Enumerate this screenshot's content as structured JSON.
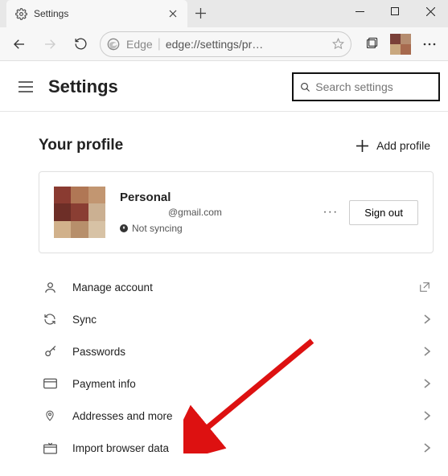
{
  "tab": {
    "title": "Settings"
  },
  "omnibox": {
    "brand": "Edge",
    "url": "edge://settings/pr…"
  },
  "page": {
    "title": "Settings"
  },
  "search": {
    "placeholder": "Search settings"
  },
  "section": {
    "title": "Your profile",
    "add_label": "Add profile"
  },
  "profile": {
    "name": "Personal",
    "email": "@gmail.com",
    "sync_status": "Not syncing",
    "signout_label": "Sign out"
  },
  "rows": [
    {
      "label": "Manage account"
    },
    {
      "label": "Sync"
    },
    {
      "label": "Passwords"
    },
    {
      "label": "Payment info"
    },
    {
      "label": "Addresses and more"
    },
    {
      "label": "Import browser data"
    }
  ]
}
